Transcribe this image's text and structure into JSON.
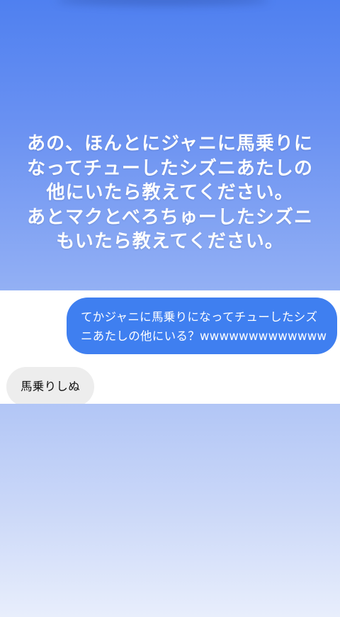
{
  "story": {
    "lines": [
      "あの、ほんとにジャニに馬乗りに",
      "なってチューしたシズニあたしの",
      "他にいたら教えてください。",
      "あとマクとべろちゅーしたシズニ",
      "もいたら教えてください。"
    ],
    "colors": {
      "gradient_top": "#4f80f0",
      "gradient_bottom": "#93b0f4",
      "text": "#ffffff"
    }
  },
  "chat": {
    "sent_message": {
      "lines": [
        "てかジャニに馬乗りになってチューしたシズ",
        "ニあたしの他にいる？wwwwwwwwwwwww"
      ],
      "bubble_color": "#3f7ff0"
    },
    "received_message": {
      "text": "馬乗りしぬ",
      "bubble_color": "#ededed"
    }
  }
}
